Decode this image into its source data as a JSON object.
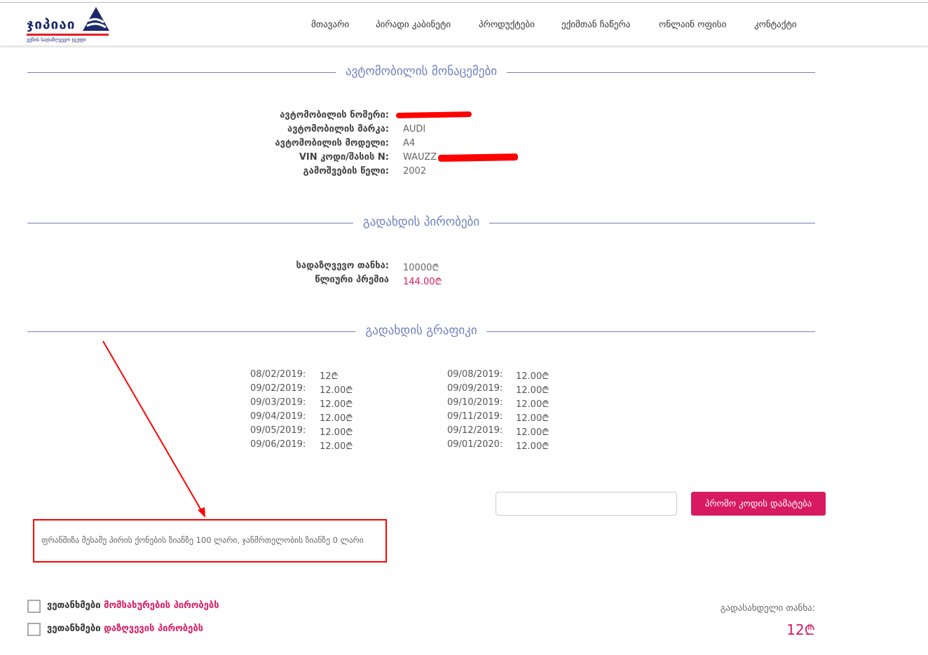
{
  "logo": {
    "name": "ჯიპიაი",
    "tagline": "ვენის სადაზღვევო ჯგუფი"
  },
  "nav": [
    "მთავარი",
    "პირადი კაბინეტი",
    "პროდუქტები",
    "ექიმთან ჩაწერა",
    "ონლაინ ოფისი",
    "კონტაქტი"
  ],
  "vehicle": {
    "title": "ავტომობილის მონაცემები",
    "rows": [
      {
        "label": "ავტომობილის ნომერი:",
        "value": ""
      },
      {
        "label": "ავტომობილის მარკა:",
        "value": "AUDI"
      },
      {
        "label": "ავტომობილის მოდელი:",
        "value": "A4"
      },
      {
        "label": "VIN კოდი/შასის N:",
        "value": "WAUZZ"
      },
      {
        "label": "გამოშვების წელი:",
        "value": "2002"
      }
    ]
  },
  "payment": {
    "title": "გადახდის პირობები",
    "sum_label": "სადაზღვევო თანხა:",
    "sum_value": "10000₾",
    "premium_label": "წლიური პრემია",
    "premium_value": "144.00₾"
  },
  "schedule": {
    "title": "გადახდის გრაფიკი",
    "left": [
      {
        "date": "08/02/2019:",
        "amount": "12₾"
      },
      {
        "date": "09/02/2019:",
        "amount": "12.00₾"
      },
      {
        "date": "09/03/2019:",
        "amount": "12.00₾"
      },
      {
        "date": "09/04/2019:",
        "amount": "12.00₾"
      },
      {
        "date": "09/05/2019:",
        "amount": "12.00₾"
      },
      {
        "date": "09/06/2019:",
        "amount": "12.00₾"
      }
    ],
    "right": [
      {
        "date": "09/08/2019:",
        "amount": "12.00₾"
      },
      {
        "date": "09/09/2019:",
        "amount": "12.00₾"
      },
      {
        "date": "09/10/2019:",
        "amount": "12.00₾"
      },
      {
        "date": "09/11/2019:",
        "amount": "12.00₾"
      },
      {
        "date": "09/12/2019:",
        "amount": "12.00₾"
      },
      {
        "date": "09/01/2020:",
        "amount": "12.00₾"
      }
    ]
  },
  "promo": {
    "input_value": "",
    "button": "პრომო კოდის დამატება"
  },
  "franchise_note": "ფრანშიზა მესამე პირის ქონების ზიანზე 100 ლარი, ჯანმრთელობის ზიანზე 0 ლარი",
  "agreements": [
    {
      "prefix": "ვეთანხმები",
      "link": "მომსახურების პირობებს"
    },
    {
      "prefix": "ვეთანხმები",
      "link": "დაზღვევის პირობებს"
    }
  ],
  "total": {
    "label": "გადასახდელი თანხა:",
    "value": "12₾"
  },
  "colors": {
    "accent": "#d81b60",
    "section": "#6f7fc0",
    "annotation": "#ff0000"
  }
}
